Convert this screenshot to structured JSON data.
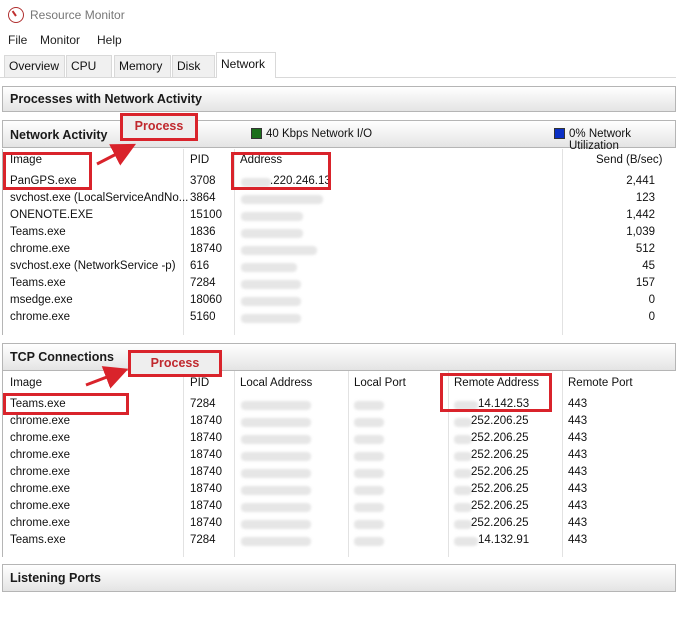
{
  "window": {
    "title": "Resource Monitor"
  },
  "menu": [
    "File",
    "Monitor",
    "Help"
  ],
  "tabs": [
    "Overview",
    "CPU",
    "Memory",
    "Disk",
    "Network"
  ],
  "active_tab": "Network",
  "processes_section": {
    "title": "Processes with Network Activity"
  },
  "network_activity": {
    "title": "Network Activity",
    "io_legend": "40 Kbps Network I/O",
    "io_color": "#1a6e1a",
    "util_legend": "0% Network Utilization",
    "util_color": "#0a2fc4",
    "columns": {
      "image": "Image",
      "pid": "PID",
      "address": "Address",
      "send": "Send (B/sec)"
    },
    "rows": [
      {
        "image": "PanGPS.exe",
        "pid": "3708",
        "address": ".220.246.13",
        "send": "2,441"
      },
      {
        "image": "svchost.exe (LocalServiceAndNo...",
        "pid": "3864",
        "address": "",
        "send": "123"
      },
      {
        "image": "ONENOTE.EXE",
        "pid": "15100",
        "address": "",
        "send": "1,442"
      },
      {
        "image": "Teams.exe",
        "pid": "1836",
        "address": "",
        "send": "1,039"
      },
      {
        "image": "chrome.exe",
        "pid": "18740",
        "address": "",
        "send": "512"
      },
      {
        "image": "svchost.exe (NetworkService -p)",
        "pid": "616",
        "address": "",
        "send": "45"
      },
      {
        "image": "Teams.exe",
        "pid": "7284",
        "address": "",
        "send": "157"
      },
      {
        "image": "msedge.exe",
        "pid": "18060",
        "address": "",
        "send": "0"
      },
      {
        "image": "chrome.exe",
        "pid": "5160",
        "address": "",
        "send": "0"
      }
    ]
  },
  "tcp_connections": {
    "title": "TCP Connections",
    "columns": {
      "image": "Image",
      "pid": "PID",
      "local_address": "Local Address",
      "local_port": "Local Port",
      "remote_address": "Remote Address",
      "remote_port": "Remote Port"
    },
    "rows": [
      {
        "image": "Teams.exe",
        "pid": "7284",
        "remote": "14.142.53",
        "port": "443"
      },
      {
        "image": "chrome.exe",
        "pid": "18740",
        "remote": "252.206.25",
        "port": "443"
      },
      {
        "image": "chrome.exe",
        "pid": "18740",
        "remote": "252.206.25",
        "port": "443"
      },
      {
        "image": "chrome.exe",
        "pid": "18740",
        "remote": "252.206.25",
        "port": "443"
      },
      {
        "image": "chrome.exe",
        "pid": "18740",
        "remote": "252.206.25",
        "port": "443"
      },
      {
        "image": "chrome.exe",
        "pid": "18740",
        "remote": "252.206.25",
        "port": "443"
      },
      {
        "image": "chrome.exe",
        "pid": "18740",
        "remote": "252.206.25",
        "port": "443"
      },
      {
        "image": "chrome.exe",
        "pid": "18740",
        "remote": "252.206.25",
        "port": "443"
      },
      {
        "image": "Teams.exe",
        "pid": "7284",
        "remote": "14.132.91",
        "port": "443"
      }
    ]
  },
  "listening_ports": {
    "title": "Listening Ports"
  },
  "annotations": {
    "callout_label": "Process",
    "highlight_color": "#d9232b"
  }
}
